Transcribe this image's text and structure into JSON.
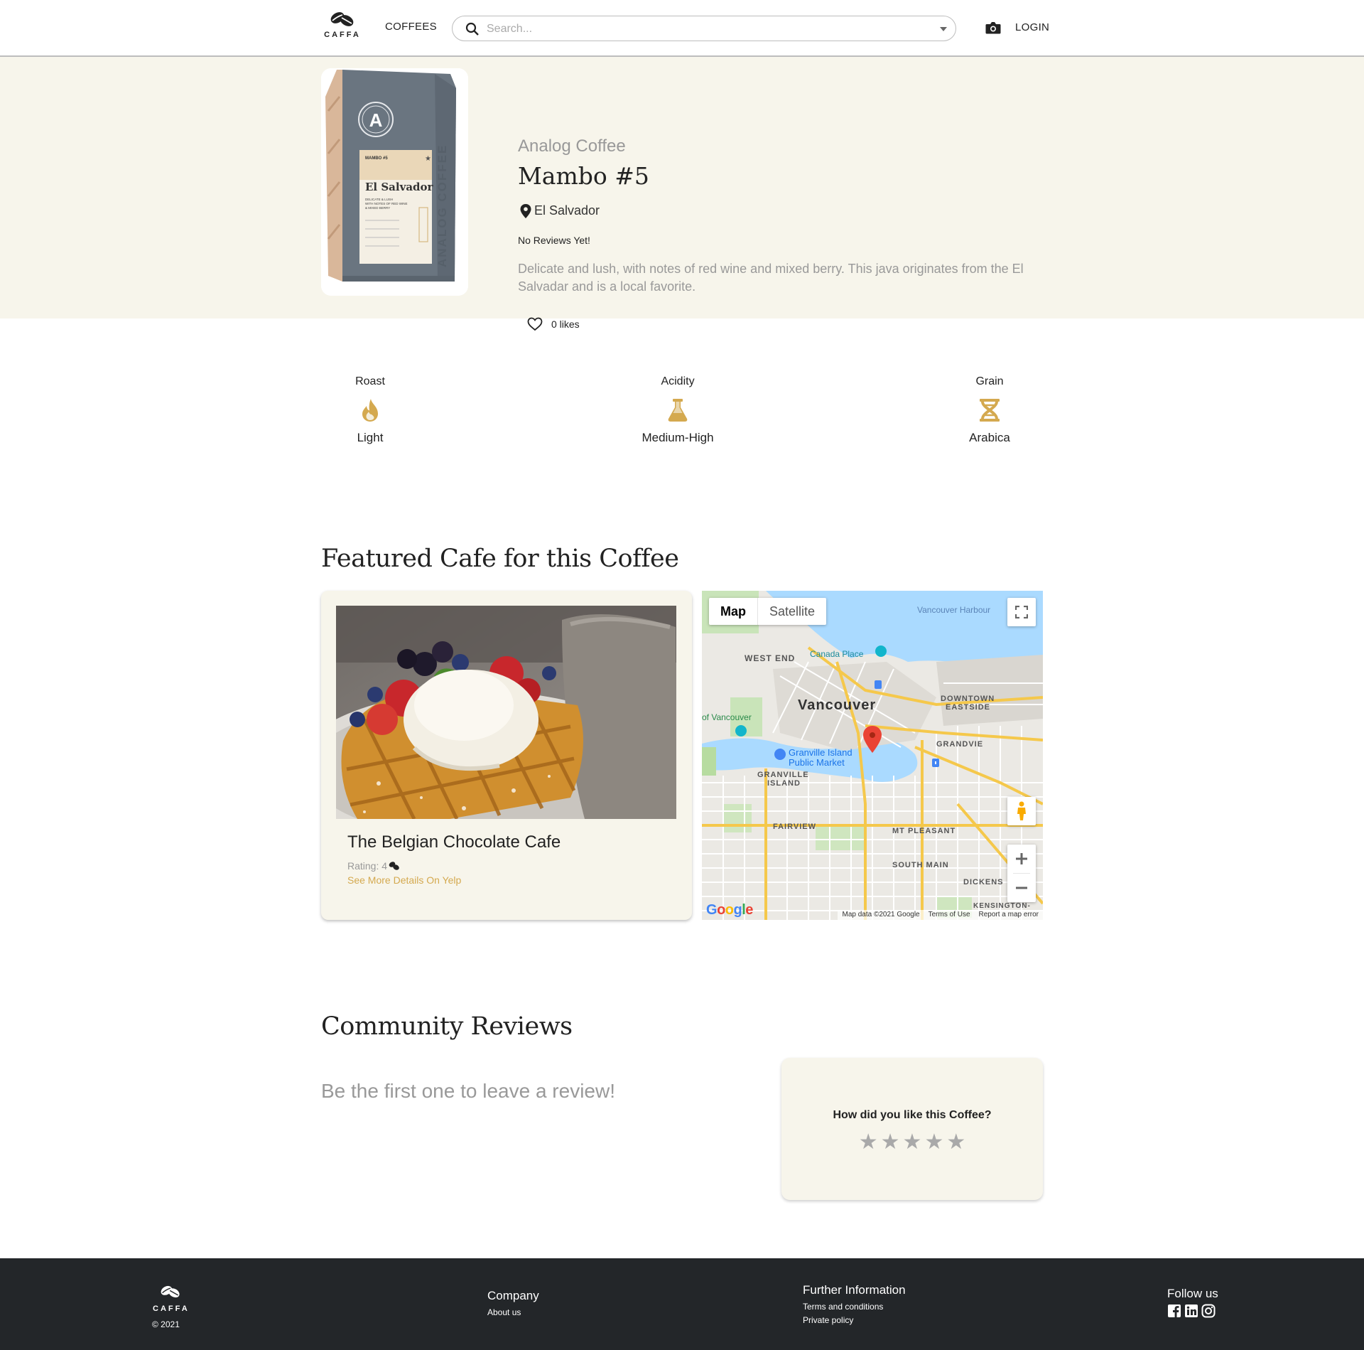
{
  "header": {
    "logo_text": "CAFFA",
    "nav_coffees": "COFFEES",
    "search_placeholder": "Search...",
    "login": "LOGIN"
  },
  "product": {
    "roaster": "Analog Coffee",
    "name": "Mambo #5",
    "origin": "El Salvador",
    "reviews_note": "No Reviews Yet!",
    "description": "Delicate and lush, with notes of red wine and mixed berry. This java originates from the El Salvadar and is a local favorite.",
    "likes": "0 likes",
    "bag": {
      "brand_letter": "A",
      "label_top": "MAMBO #5",
      "label_origin": "El Salvador",
      "label_notes": "DELICATE & LUSH WITH NOTES OF RED WINE & MIXED BERRY",
      "side_text": "ANALOG COFFEE"
    }
  },
  "attributes": [
    {
      "label": "Roast",
      "value": "Light",
      "icon": "flame-icon"
    },
    {
      "label": "Acidity",
      "value": "Medium-High",
      "icon": "flask-icon"
    },
    {
      "label": "Grain",
      "value": "Arabica",
      "icon": "dna-icon"
    }
  ],
  "featured": {
    "title": "Featured Cafe for this Coffee",
    "cafe_name": "The Belgian Chocolate Cafe",
    "rating_label": "Rating: 4",
    "yelp_link": "See More Details On Yelp",
    "map": {
      "type_map": "Map",
      "type_satellite": "Satellite",
      "labels": {
        "harbour": "Vancouver Harbour",
        "west_end": "WEST END",
        "canada_place": "Canada Place",
        "vancouver": "Vancouver",
        "downtown": "DOWNTOWN",
        "eastside": "EASTSIDE",
        "granville_island": "Granville Island",
        "public_market": "Public Market",
        "granville": "GRANVILLE",
        "island": "ISLAND",
        "fairview": "FAIRVIEW",
        "mt_pleasant": "MT PLEASANT",
        "south_main": "SOUTH MAIN",
        "dickens": "DICKENS",
        "grandview": "GRANDVIE",
        "kensington": "KENSINGTON-",
        "of_vancouver": "of Vancouver"
      },
      "google": "Google",
      "map_data": "Map data ©2021 Google",
      "terms": "Terms of Use",
      "report": "Report a map error",
      "accent_color": "#f5c84b",
      "water_color": "#aadaff",
      "pin_color": "#ea4335"
    }
  },
  "reviews": {
    "title": "Community Reviews",
    "empty": "Be the first one to leave a review!",
    "prompt": "How did you like this Coffee?",
    "stars": 5
  },
  "footer": {
    "logo_text": "CAFFA",
    "copyright": "© 2021",
    "company_head": "Company",
    "about": "About us",
    "info_head": "Further Information",
    "terms": "Terms and conditions",
    "privacy": "Private policy",
    "follow_head": "Follow us",
    "social": [
      "facebook-icon",
      "linkedin-icon",
      "instagram-icon"
    ]
  },
  "colors": {
    "hero_bg": "#f7f5eb",
    "accent_gold": "#d4a94f",
    "footer_bg": "#232629",
    "muted_text": "#999999"
  }
}
